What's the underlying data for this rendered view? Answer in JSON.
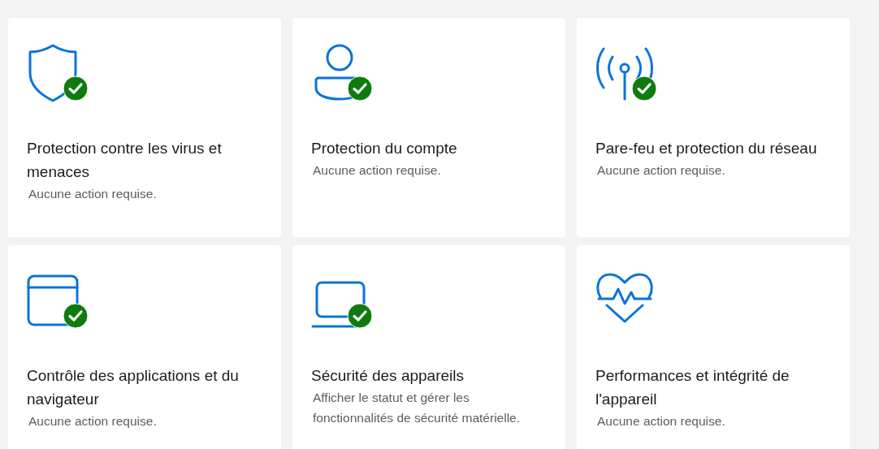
{
  "cards": [
    {
      "kind": "shield",
      "checked": true,
      "title": "Protection contre les virus et menaces",
      "description": "Aucune action requise."
    },
    {
      "kind": "person",
      "checked": true,
      "title": "Protection du compte",
      "description": "Aucune action requise."
    },
    {
      "kind": "antenna",
      "checked": true,
      "title": "Pare-feu et protection du réseau",
      "description": "Aucune action requise."
    },
    {
      "kind": "window",
      "checked": true,
      "title": "Contrôle des applications et du navigateur",
      "description": "Aucune action requise."
    },
    {
      "kind": "laptop",
      "checked": true,
      "title": "Sécurité des appareils",
      "description": "Afficher le statut et gérer les fonctionnalités de sécurité matérielle."
    },
    {
      "kind": "heart",
      "checked": false,
      "title": "Performances et intégrité de l'appareil",
      "description": "Aucune action requise."
    }
  ]
}
